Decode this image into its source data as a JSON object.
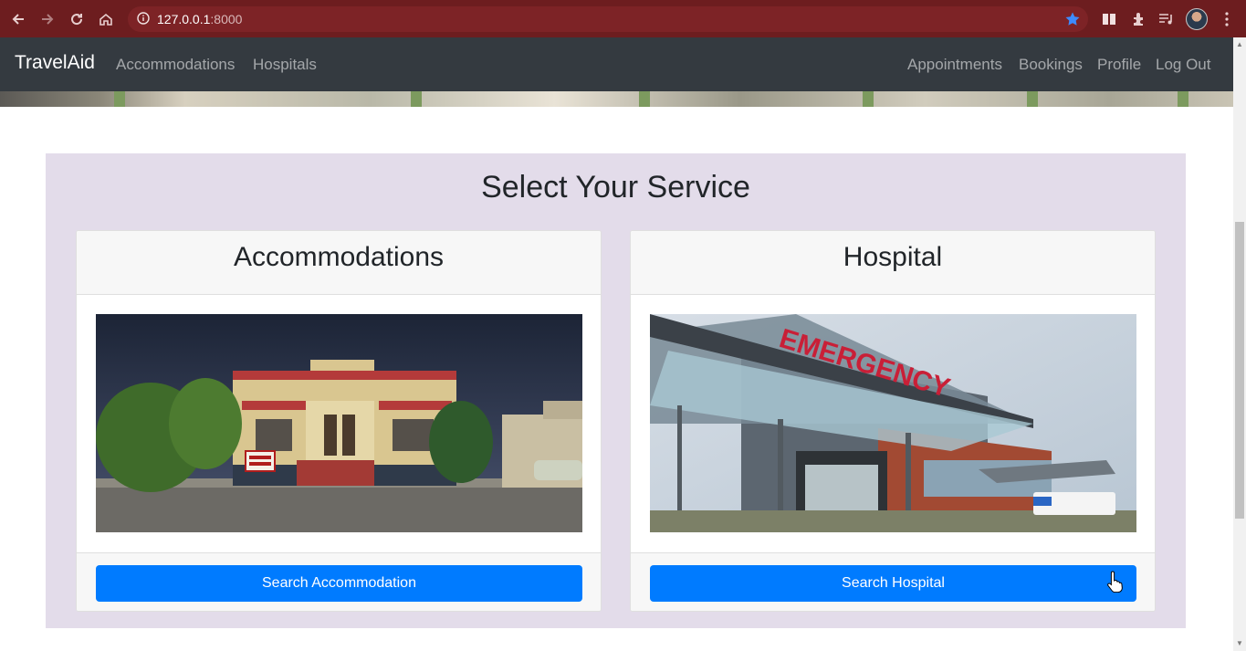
{
  "browser": {
    "url_host": "127.0.0.1",
    "url_port": ":8000",
    "icons": [
      "back-arrow-icon",
      "forward-arrow-icon",
      "reload-icon",
      "home-icon",
      "info-icon",
      "star-icon",
      "reading-list-icon",
      "extensions-icon",
      "media-icon",
      "profile-avatar",
      "menu-icon"
    ],
    "accent": "#6d1d1f"
  },
  "navbar": {
    "brand": "TravelAid",
    "left_links": [
      "Accommodations",
      "Hospitals"
    ],
    "right_links": [
      "Appointments",
      "Bookings",
      "Profile",
      "Log Out"
    ],
    "bg": "#343a40"
  },
  "services": {
    "title": "Select Your Service",
    "cards": [
      {
        "header": "Accommodations",
        "image": "house-for-rent-photo",
        "button": "Search Accommodation"
      },
      {
        "header": "Hospital",
        "image": "hospital-emergency-photo",
        "image_sign": "EMERGENCY",
        "button": "Search Hospital"
      }
    ],
    "panel_bg": "#e3dcea",
    "button_color": "#007bff"
  }
}
